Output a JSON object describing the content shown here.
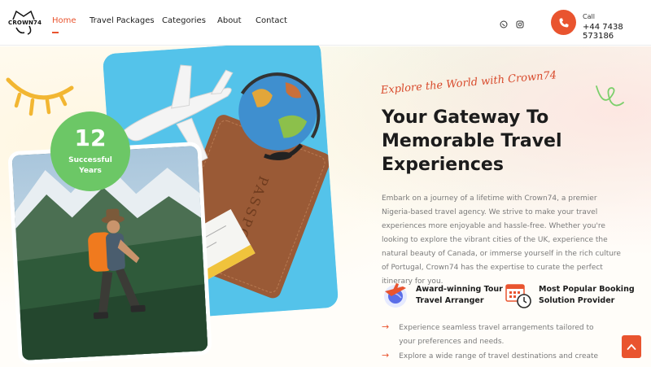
{
  "header": {
    "logo_text": "CROWN74",
    "nav": [
      {
        "label": "Home",
        "active": true
      },
      {
        "label": "Travel Packages",
        "active": false
      },
      {
        "label": "Categories",
        "active": false
      },
      {
        "label": "About",
        "active": false
      },
      {
        "label": "Contact",
        "active": false
      }
    ],
    "social": [
      "whatsapp-icon",
      "instagram-icon"
    ],
    "call_label": "Call",
    "call_number": "+44 7438 573186"
  },
  "hero": {
    "badge": {
      "number": "12",
      "line1": "Successful",
      "line2": "Years"
    },
    "script_tagline": "Explore the World with Crown74",
    "title_lines": [
      "Your Gateway To",
      "Memorable Travel",
      "Experiences"
    ],
    "description": "Embark on a journey of a lifetime with Crown74, a premier Nigeria-based travel agency. We strive to make your travel experiences more enjoyable and hassle-free. Whether you're looking to explore the vibrant cities of the UK, experience the natural beauty of Canada, or immerse yourself in the rich culture of Portugal, Crown74 has the expertise to curate the perfect itinerary for you.",
    "features": [
      {
        "icon": "plane-globe-icon",
        "line1": "Award-winning Tour &",
        "line2": "Travel Arranger"
      },
      {
        "icon": "calendar-clock-icon",
        "line1": "Most Popular Booking",
        "line2": "Solution Provider"
      }
    ],
    "bullets": [
      "Experience seamless travel arrangements tailored to your preferences and needs.",
      "Explore a wide range of travel destinations and create"
    ]
  },
  "colors": {
    "accent": "#e9542f",
    "badge": "#6cc766",
    "title": "#1c1c1c",
    "body": "#7a7a7a"
  }
}
